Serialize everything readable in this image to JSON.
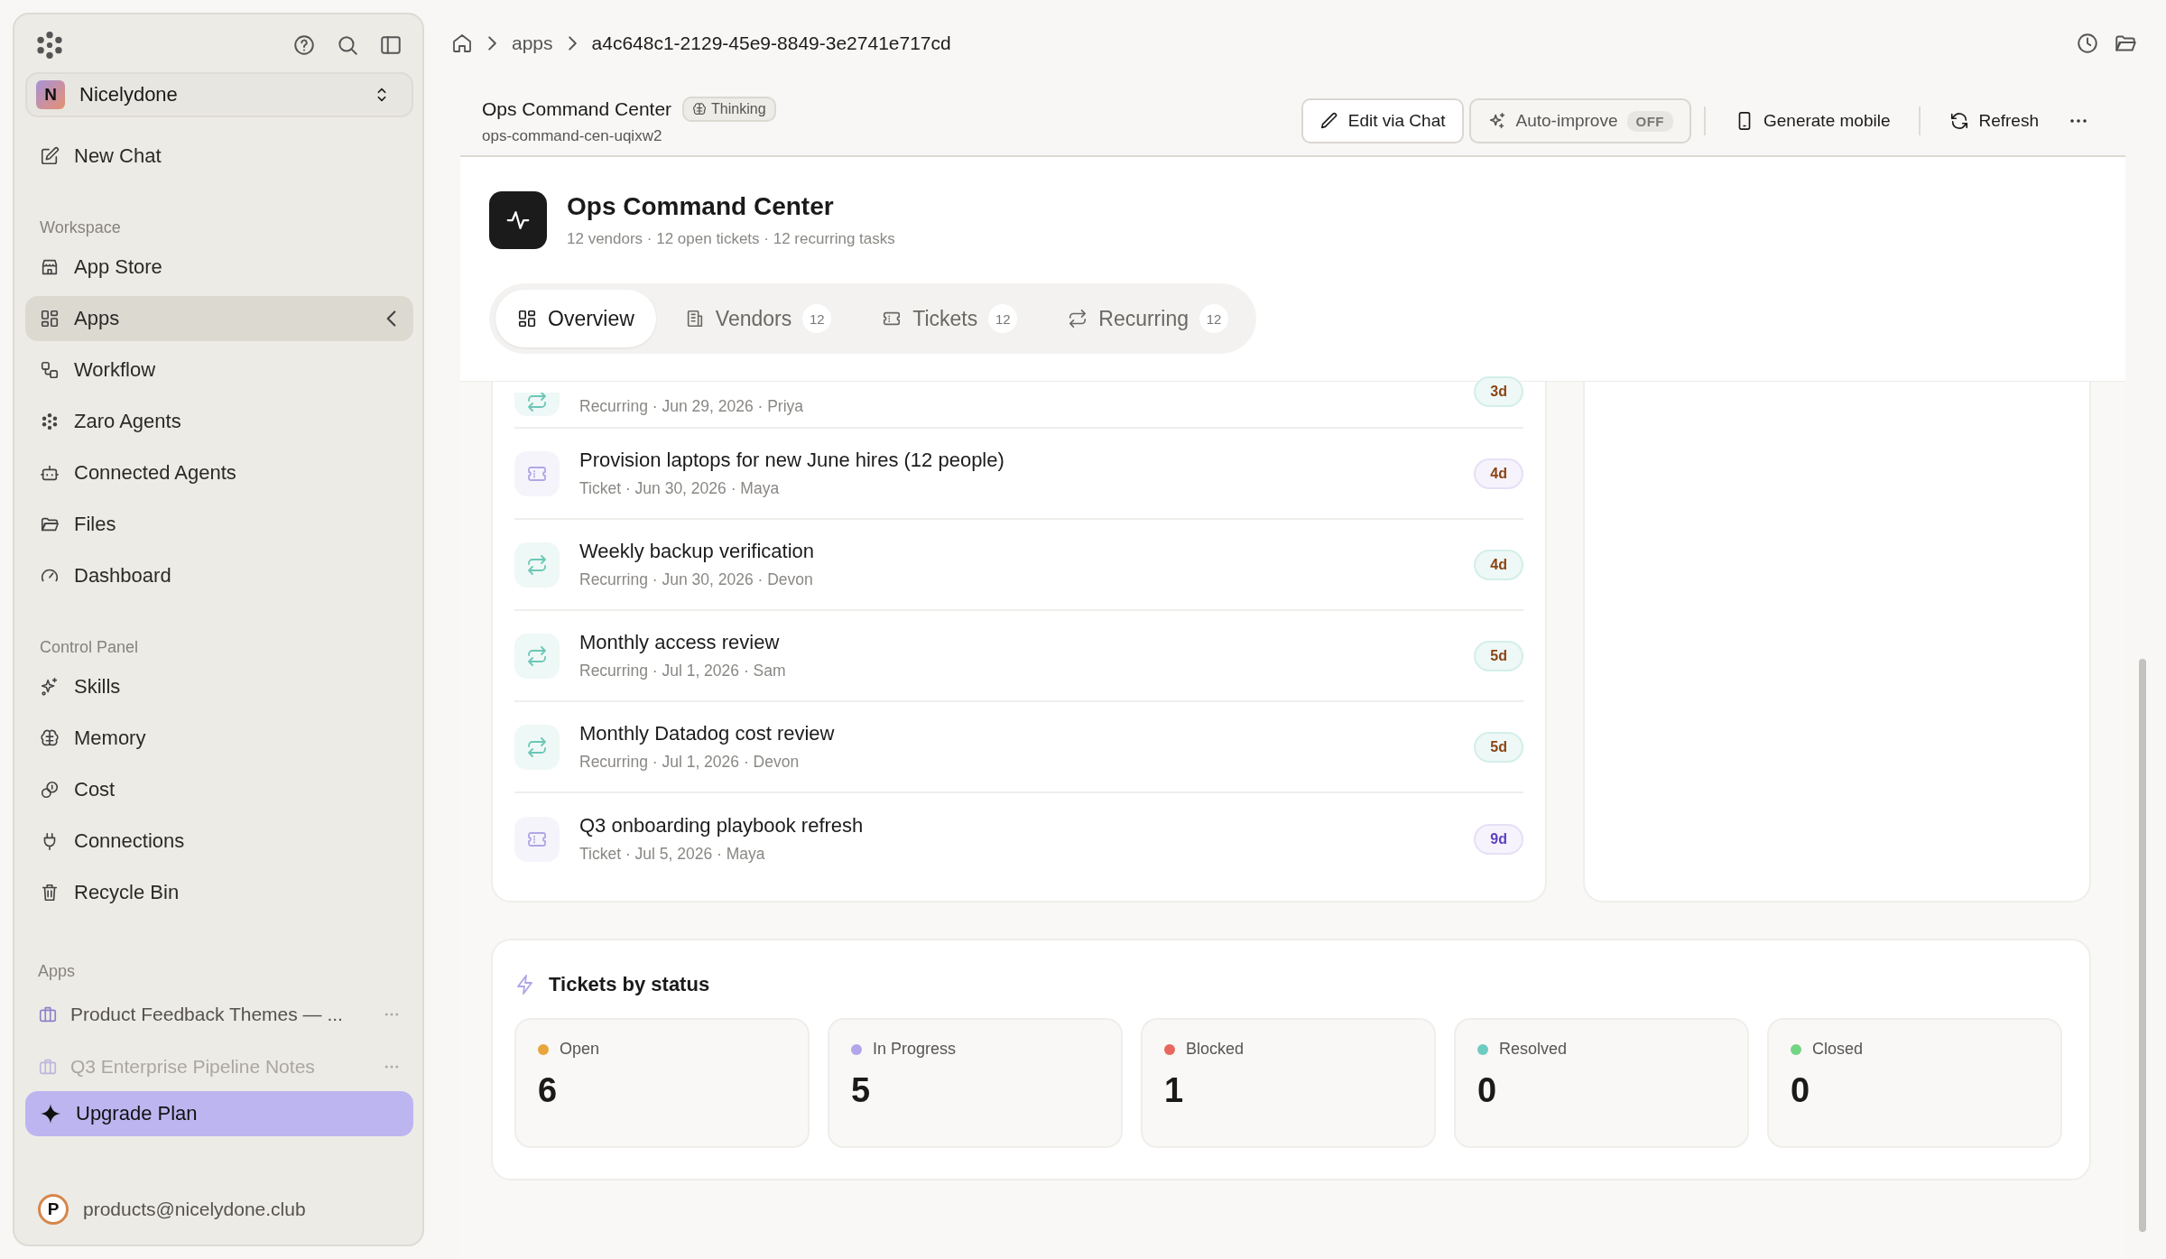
{
  "sidebar": {
    "workspace": {
      "initial": "N",
      "name": "Nicelydone"
    },
    "new_chat": "New Chat",
    "sections": [
      {
        "heading": "Workspace",
        "items": [
          {
            "label": "App Store",
            "selected": false
          },
          {
            "label": "Apps",
            "selected": true
          },
          {
            "label": "Workflow",
            "selected": false
          },
          {
            "label": "Zaro Agents",
            "selected": false
          },
          {
            "label": "Connected Agents",
            "selected": false
          },
          {
            "label": "Files",
            "selected": false
          },
          {
            "label": "Dashboard",
            "selected": false
          }
        ]
      },
      {
        "heading": "Control Panel",
        "items": [
          {
            "label": "Skills",
            "selected": false
          },
          {
            "label": "Memory",
            "selected": false
          },
          {
            "label": "Cost",
            "selected": false
          },
          {
            "label": "Connections",
            "selected": false
          },
          {
            "label": "Recycle Bin",
            "selected": false
          }
        ]
      }
    ],
    "apps_heading": "Apps",
    "apps": [
      {
        "label": "Product Feedback Themes — ...",
        "dimmed": false
      },
      {
        "label": "Q3 Enterprise Pipeline Notes",
        "dimmed": true
      }
    ],
    "upgrade": "Upgrade Plan",
    "user": {
      "initial": "P",
      "email": "products@nicelydone.club"
    }
  },
  "breadcrumb": [
    "apps",
    "a4c648c1-2129-45e9-8849-3e2741e717cd"
  ],
  "app_bar": {
    "title": "Ops Command Center",
    "status": "Thinking",
    "slug": "ops-command-cen-uqixw2",
    "buttons": [
      {
        "label": "Edit via Chat",
        "kind": "outlined"
      },
      {
        "label": "Auto-improve",
        "kind": "toggle",
        "toggle": "OFF"
      },
      {
        "label": "Generate mobile",
        "kind": "plain"
      },
      {
        "label": "Refresh",
        "kind": "plain"
      }
    ]
  },
  "app": {
    "title": "Ops Command Center",
    "subtitle": "12 vendors · 12 open tickets · 12 recurring tasks",
    "tabs": [
      {
        "label": "Overview",
        "selected": true
      },
      {
        "label": "Vendors",
        "count": "12",
        "selected": false
      },
      {
        "label": "Tickets",
        "count": "12",
        "selected": false
      },
      {
        "label": "Recurring",
        "count": "12",
        "selected": false
      }
    ]
  },
  "tasks": [
    {
      "kind": "recurring",
      "meta": "Recurring · Jun 29, 2026 · Priya",
      "due": "3d",
      "color": "#8b4513"
    },
    {
      "kind": "ticket",
      "title": "Provision laptops for new June hires (12 people)",
      "meta": "Ticket · Jun 30, 2026 · Maya",
      "due": "4d",
      "color": "#8b4513"
    },
    {
      "kind": "recurring",
      "title": "Weekly backup verification",
      "meta": "Recurring · Jun 30, 2026 · Devon",
      "due": "4d",
      "color": "#8b4513"
    },
    {
      "kind": "recurring",
      "title": "Monthly access review",
      "meta": "Recurring · Jul 1, 2026 · Sam",
      "due": "5d",
      "color": "#8b4513"
    },
    {
      "kind": "recurring",
      "title": "Monthly Datadog cost review",
      "meta": "Recurring · Jul 1, 2026 · Devon",
      "due": "5d",
      "color": "#8b4513"
    },
    {
      "kind": "ticket",
      "title": "Q3 onboarding playbook refresh",
      "meta": "Ticket · Jul 5, 2026 · Maya",
      "due": "9d",
      "color": "#5b3fc4"
    }
  ],
  "tickets_by_status": {
    "title": "Tickets by status",
    "statuses": [
      {
        "label": "Open",
        "color": "#e8a53d",
        "count": "6"
      },
      {
        "label": "In Progress",
        "color": "#b3a5ea",
        "count": "5"
      },
      {
        "label": "Blocked",
        "color": "#e8675e",
        "count": "1"
      },
      {
        "label": "Resolved",
        "color": "#6fcbc2",
        "count": "0"
      },
      {
        "label": "Closed",
        "color": "#74d485",
        "count": "0"
      }
    ]
  }
}
